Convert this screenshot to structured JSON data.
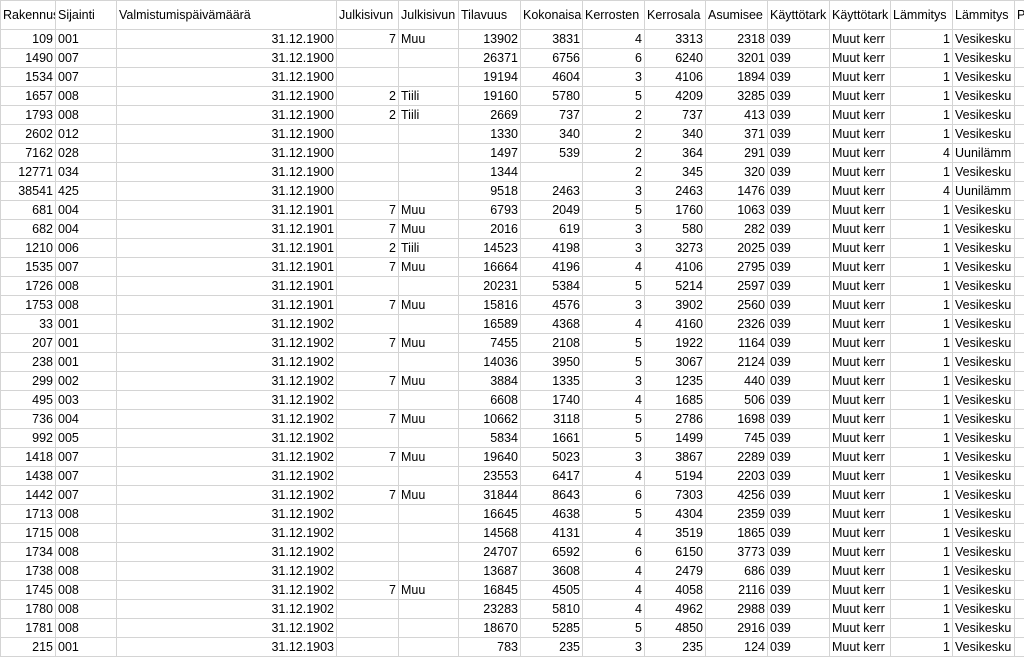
{
  "headers": [
    "Rakennus",
    "Sijainti",
    "Valmistumispäivämäärä",
    "Julkisivun",
    "Julkisivun",
    "Tilavuus",
    "Kokonaisa",
    "Kerrosten",
    "Kerrosala",
    "Asumisee",
    "Käyttötark",
    "Käyttötark",
    "Lämmitys",
    "Lämmitys",
    "P"
  ],
  "rows": [
    [
      "109",
      "001",
      "31.12.1900",
      "7",
      "Muu",
      "13902",
      "3831",
      "4",
      "3313",
      "2318",
      "039",
      "Muut kerr",
      "1",
      "Vesikesku",
      ""
    ],
    [
      "1490",
      "007",
      "31.12.1900",
      "",
      "",
      "26371",
      "6756",
      "6",
      "6240",
      "3201",
      "039",
      "Muut kerr",
      "1",
      "Vesikesku",
      ""
    ],
    [
      "1534",
      "007",
      "31.12.1900",
      "",
      "",
      "19194",
      "4604",
      "3",
      "4106",
      "1894",
      "039",
      "Muut kerr",
      "1",
      "Vesikesku",
      ""
    ],
    [
      "1657",
      "008",
      "31.12.1900",
      "2",
      "Tiili",
      "19160",
      "5780",
      "5",
      "4209",
      "3285",
      "039",
      "Muut kerr",
      "1",
      "Vesikesku",
      ""
    ],
    [
      "1793",
      "008",
      "31.12.1900",
      "2",
      "Tiili",
      "2669",
      "737",
      "2",
      "737",
      "413",
      "039",
      "Muut kerr",
      "1",
      "Vesikesku",
      ""
    ],
    [
      "2602",
      "012",
      "31.12.1900",
      "",
      "",
      "1330",
      "340",
      "2",
      "340",
      "371",
      "039",
      "Muut kerr",
      "1",
      "Vesikesku",
      ""
    ],
    [
      "7162",
      "028",
      "31.12.1900",
      "",
      "",
      "1497",
      "539",
      "2",
      "364",
      "291",
      "039",
      "Muut kerr",
      "4",
      "Uunilämm",
      ""
    ],
    [
      "12771",
      "034",
      "31.12.1900",
      "",
      "",
      "1344",
      "",
      "2",
      "345",
      "320",
      "039",
      "Muut kerr",
      "1",
      "Vesikesku",
      ""
    ],
    [
      "38541",
      "425",
      "31.12.1900",
      "",
      "",
      "9518",
      "2463",
      "3",
      "2463",
      "1476",
      "039",
      "Muut kerr",
      "4",
      "Uunilämm",
      ""
    ],
    [
      "681",
      "004",
      "31.12.1901",
      "7",
      "Muu",
      "6793",
      "2049",
      "5",
      "1760",
      "1063",
      "039",
      "Muut kerr",
      "1",
      "Vesikesku",
      ""
    ],
    [
      "682",
      "004",
      "31.12.1901",
      "7",
      "Muu",
      "2016",
      "619",
      "3",
      "580",
      "282",
      "039",
      "Muut kerr",
      "1",
      "Vesikesku",
      ""
    ],
    [
      "1210",
      "006",
      "31.12.1901",
      "2",
      "Tiili",
      "14523",
      "4198",
      "3",
      "3273",
      "2025",
      "039",
      "Muut kerr",
      "1",
      "Vesikesku",
      ""
    ],
    [
      "1535",
      "007",
      "31.12.1901",
      "7",
      "Muu",
      "16664",
      "4196",
      "4",
      "4106",
      "2795",
      "039",
      "Muut kerr",
      "1",
      "Vesikesku",
      ""
    ],
    [
      "1726",
      "008",
      "31.12.1901",
      "",
      "",
      "20231",
      "5384",
      "5",
      "5214",
      "2597",
      "039",
      "Muut kerr",
      "1",
      "Vesikesku",
      ""
    ],
    [
      "1753",
      "008",
      "31.12.1901",
      "7",
      "Muu",
      "15816",
      "4576",
      "3",
      "3902",
      "2560",
      "039",
      "Muut kerr",
      "1",
      "Vesikesku",
      ""
    ],
    [
      "33",
      "001",
      "31.12.1902",
      "",
      "",
      "16589",
      "4368",
      "4",
      "4160",
      "2326",
      "039",
      "Muut kerr",
      "1",
      "Vesikesku",
      ""
    ],
    [
      "207",
      "001",
      "31.12.1902",
      "7",
      "Muu",
      "7455",
      "2108",
      "5",
      "1922",
      "1164",
      "039",
      "Muut kerr",
      "1",
      "Vesikesku",
      ""
    ],
    [
      "238",
      "001",
      "31.12.1902",
      "",
      "",
      "14036",
      "3950",
      "5",
      "3067",
      "2124",
      "039",
      "Muut kerr",
      "1",
      "Vesikesku",
      ""
    ],
    [
      "299",
      "002",
      "31.12.1902",
      "7",
      "Muu",
      "3884",
      "1335",
      "3",
      "1235",
      "440",
      "039",
      "Muut kerr",
      "1",
      "Vesikesku",
      ""
    ],
    [
      "495",
      "003",
      "31.12.1902",
      "",
      "",
      "6608",
      "1740",
      "4",
      "1685",
      "506",
      "039",
      "Muut kerr",
      "1",
      "Vesikesku",
      ""
    ],
    [
      "736",
      "004",
      "31.12.1902",
      "7",
      "Muu",
      "10662",
      "3118",
      "5",
      "2786",
      "1698",
      "039",
      "Muut kerr",
      "1",
      "Vesikesku",
      ""
    ],
    [
      "992",
      "005",
      "31.12.1902",
      "",
      "",
      "5834",
      "1661",
      "5",
      "1499",
      "745",
      "039",
      "Muut kerr",
      "1",
      "Vesikesku",
      ""
    ],
    [
      "1418",
      "007",
      "31.12.1902",
      "7",
      "Muu",
      "19640",
      "5023",
      "3",
      "3867",
      "2289",
      "039",
      "Muut kerr",
      "1",
      "Vesikesku",
      ""
    ],
    [
      "1438",
      "007",
      "31.12.1902",
      "",
      "",
      "23553",
      "6417",
      "4",
      "5194",
      "2203",
      "039",
      "Muut kerr",
      "1",
      "Vesikesku",
      ""
    ],
    [
      "1442",
      "007",
      "31.12.1902",
      "7",
      "Muu",
      "31844",
      "8643",
      "6",
      "7303",
      "4256",
      "039",
      "Muut kerr",
      "1",
      "Vesikesku",
      ""
    ],
    [
      "1713",
      "008",
      "31.12.1902",
      "",
      "",
      "16645",
      "4638",
      "5",
      "4304",
      "2359",
      "039",
      "Muut kerr",
      "1",
      "Vesikesku",
      ""
    ],
    [
      "1715",
      "008",
      "31.12.1902",
      "",
      "",
      "14568",
      "4131",
      "4",
      "3519",
      "1865",
      "039",
      "Muut kerr",
      "1",
      "Vesikesku",
      ""
    ],
    [
      "1734",
      "008",
      "31.12.1902",
      "",
      "",
      "24707",
      "6592",
      "6",
      "6150",
      "3773",
      "039",
      "Muut kerr",
      "1",
      "Vesikesku",
      ""
    ],
    [
      "1738",
      "008",
      "31.12.1902",
      "",
      "",
      "13687",
      "3608",
      "4",
      "2479",
      "686",
      "039",
      "Muut kerr",
      "1",
      "Vesikesku",
      ""
    ],
    [
      "1745",
      "008",
      "31.12.1902",
      "7",
      "Muu",
      "16845",
      "4505",
      "4",
      "4058",
      "2116",
      "039",
      "Muut kerr",
      "1",
      "Vesikesku",
      ""
    ],
    [
      "1780",
      "008",
      "31.12.1902",
      "",
      "",
      "23283",
      "5810",
      "4",
      "4962",
      "2988",
      "039",
      "Muut kerr",
      "1",
      "Vesikesku",
      ""
    ],
    [
      "1781",
      "008",
      "31.12.1902",
      "",
      "",
      "18670",
      "5285",
      "5",
      "4850",
      "2916",
      "039",
      "Muut kerr",
      "1",
      "Vesikesku",
      ""
    ],
    [
      "215",
      "001",
      "31.12.1903",
      "",
      "",
      "783",
      "235",
      "3",
      "235",
      "124",
      "039",
      "Muut kerr",
      "1",
      "Vesikesku",
      ""
    ]
  ]
}
